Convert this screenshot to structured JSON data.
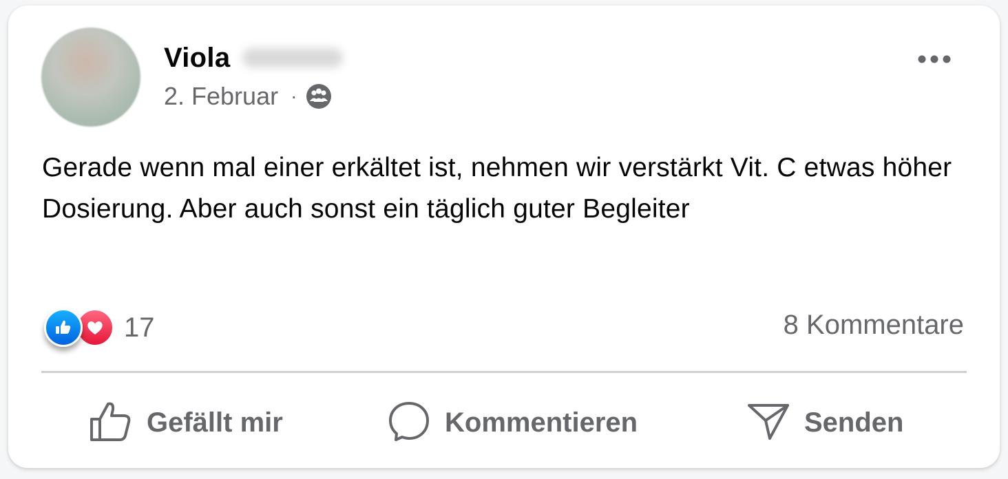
{
  "post": {
    "author_name": "Viola",
    "date": "2. Februar",
    "separator": "·",
    "audience_icon": "friends-icon",
    "more_icon": "more-options-icon",
    "text": "Gerade wenn mal einer erkältet ist, nehmen wir verstärkt Vit. C etwas höher Dosierung. Aber auch sonst ein täglich guter Begleiter"
  },
  "stats": {
    "reactions": [
      "like",
      "love"
    ],
    "reaction_count": "17",
    "comments_label": "8 Kommentare"
  },
  "actions": {
    "like_label": "Gefällt mir",
    "comment_label": "Kommentieren",
    "send_label": "Senden"
  },
  "colors": {
    "like_blue": "#0866ff",
    "love_red": "#f33e58",
    "secondary_text": "#65676b",
    "primary_text": "#050505",
    "divider": "#ced0d4"
  }
}
